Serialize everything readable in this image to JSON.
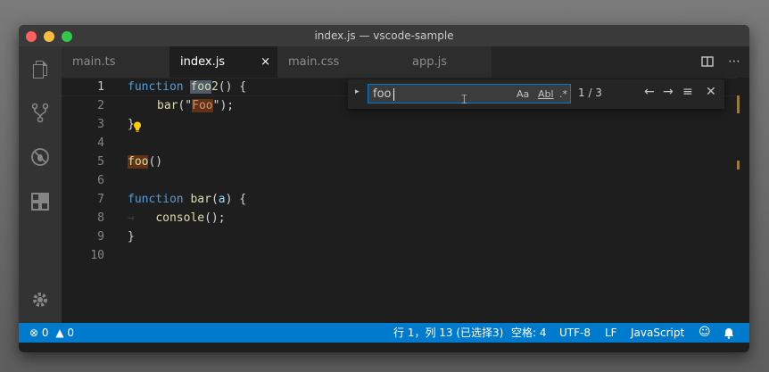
{
  "window": {
    "title": "index.js — vscode-sample"
  },
  "activity_bar": {
    "items": [
      {
        "icon": "files-icon"
      },
      {
        "icon": "source-control-icon"
      },
      {
        "icon": "debug-icon"
      },
      {
        "icon": "extensions-icon"
      }
    ],
    "settings_icon": "gear-icon"
  },
  "tabs": [
    {
      "label": "main.ts",
      "active": false
    },
    {
      "label": "index.js",
      "active": true,
      "close": "×"
    },
    {
      "label": "main.css",
      "active": false
    },
    {
      "label": "app.js",
      "active": false
    }
  ],
  "tab_actions": {
    "split": "split-editor-icon",
    "more": "⋯"
  },
  "editor": {
    "line_numbers": [
      "1",
      "2",
      "3",
      "4",
      "5",
      "6",
      "7",
      "8",
      "9",
      "10"
    ],
    "active_line": "1",
    "lines": {
      "l1": {
        "kw": "function",
        "sp": " ",
        "match": "foo",
        "rest": "2",
        "tail": "() {"
      },
      "l2": {
        "fn": "bar",
        "open": "(\"",
        "match": "Foo",
        "close": "\");"
      },
      "l3": {
        "text": "}"
      },
      "l5": {
        "match": "foo",
        "tail": "()"
      },
      "l7": {
        "kw": "function",
        "fn": "bar",
        "open": "(",
        "param": "a",
        "tail": ") {"
      },
      "l8": {
        "arrow": "→",
        "fn": "console",
        "tail": "();"
      },
      "l9": {
        "text": "}"
      }
    }
  },
  "find_widget": {
    "toggle": "▸",
    "input_value": "foo",
    "options": {
      "match_case": "Aa",
      "whole_word": "Abl",
      "regex": ".*"
    },
    "result_count": "1 / 3",
    "prev": "←",
    "next": "→",
    "in_selection": "≡",
    "close": "✕"
  },
  "status_bar": {
    "errors": "0",
    "warnings": "0",
    "position": "行 1，列 13 (已选择3)",
    "spaces": "空格: 4",
    "encoding": "UTF-8",
    "eol": "LF",
    "language": "JavaScript",
    "feedback_icon": "smiley-icon",
    "bell_icon": "bell-icon"
  },
  "colors": {
    "status_bar": "#007acc",
    "keyword": "#569cd6",
    "function": "#dcdcaa",
    "string": "#ce9178",
    "match_highlight": "#613214"
  }
}
